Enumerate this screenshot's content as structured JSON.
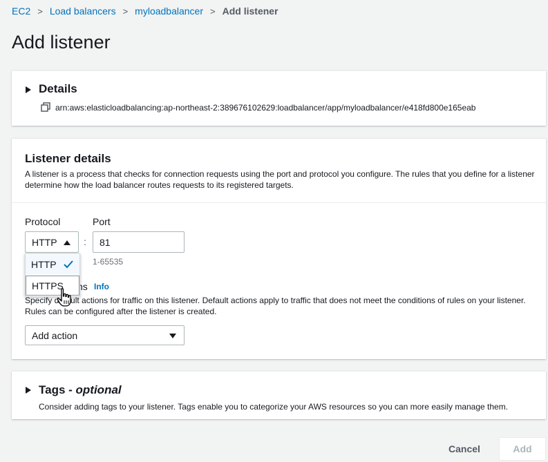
{
  "breadcrumb": {
    "items": [
      "EC2",
      "Load balancers",
      "myloadbalancer"
    ],
    "current": "Add listener",
    "separator": ">"
  },
  "page": {
    "title": "Add listener"
  },
  "details": {
    "title": "Details",
    "arn": "arn:aws:elasticloadbalancing:ap-northeast-2:389676102629:loadbalancer/app/myloadbalancer/e418fd800e165eab"
  },
  "listener": {
    "title": "Listener details",
    "description": "A listener is a process that checks for connection requests using the port and protocol you configure. The rules that you define for a listener determine how the load balancer routes requests to its registered targets.",
    "protocol_label": "Protocol",
    "protocol_value": "HTTP",
    "protocol_options": [
      "HTTP",
      "HTTPS"
    ],
    "colon": ":",
    "port_label": "Port",
    "port_value": "81",
    "port_hint": "1-65535",
    "default_actions_label_visible": "ns",
    "info_link": "Info",
    "default_actions_description": "Specify default actions for traffic on this listener. Default actions apply to traffic that does not meet the conditions of rules on your listener. Rules can be configured after the listener is created.",
    "add_action_placeholder": "Add action"
  },
  "tags": {
    "title": "Tags",
    "title_sep": " - ",
    "title_optional": "optional",
    "description": "Consider adding tags to your listener. Tags enable you to categorize your AWS resources so you can more easily manage them."
  },
  "footer": {
    "cancel_label": "Cancel",
    "add_label": "Add"
  },
  "colors": {
    "link": "#0073bb",
    "text": "#16191f",
    "muted": "#545b64",
    "background": "#f2f3f3"
  }
}
